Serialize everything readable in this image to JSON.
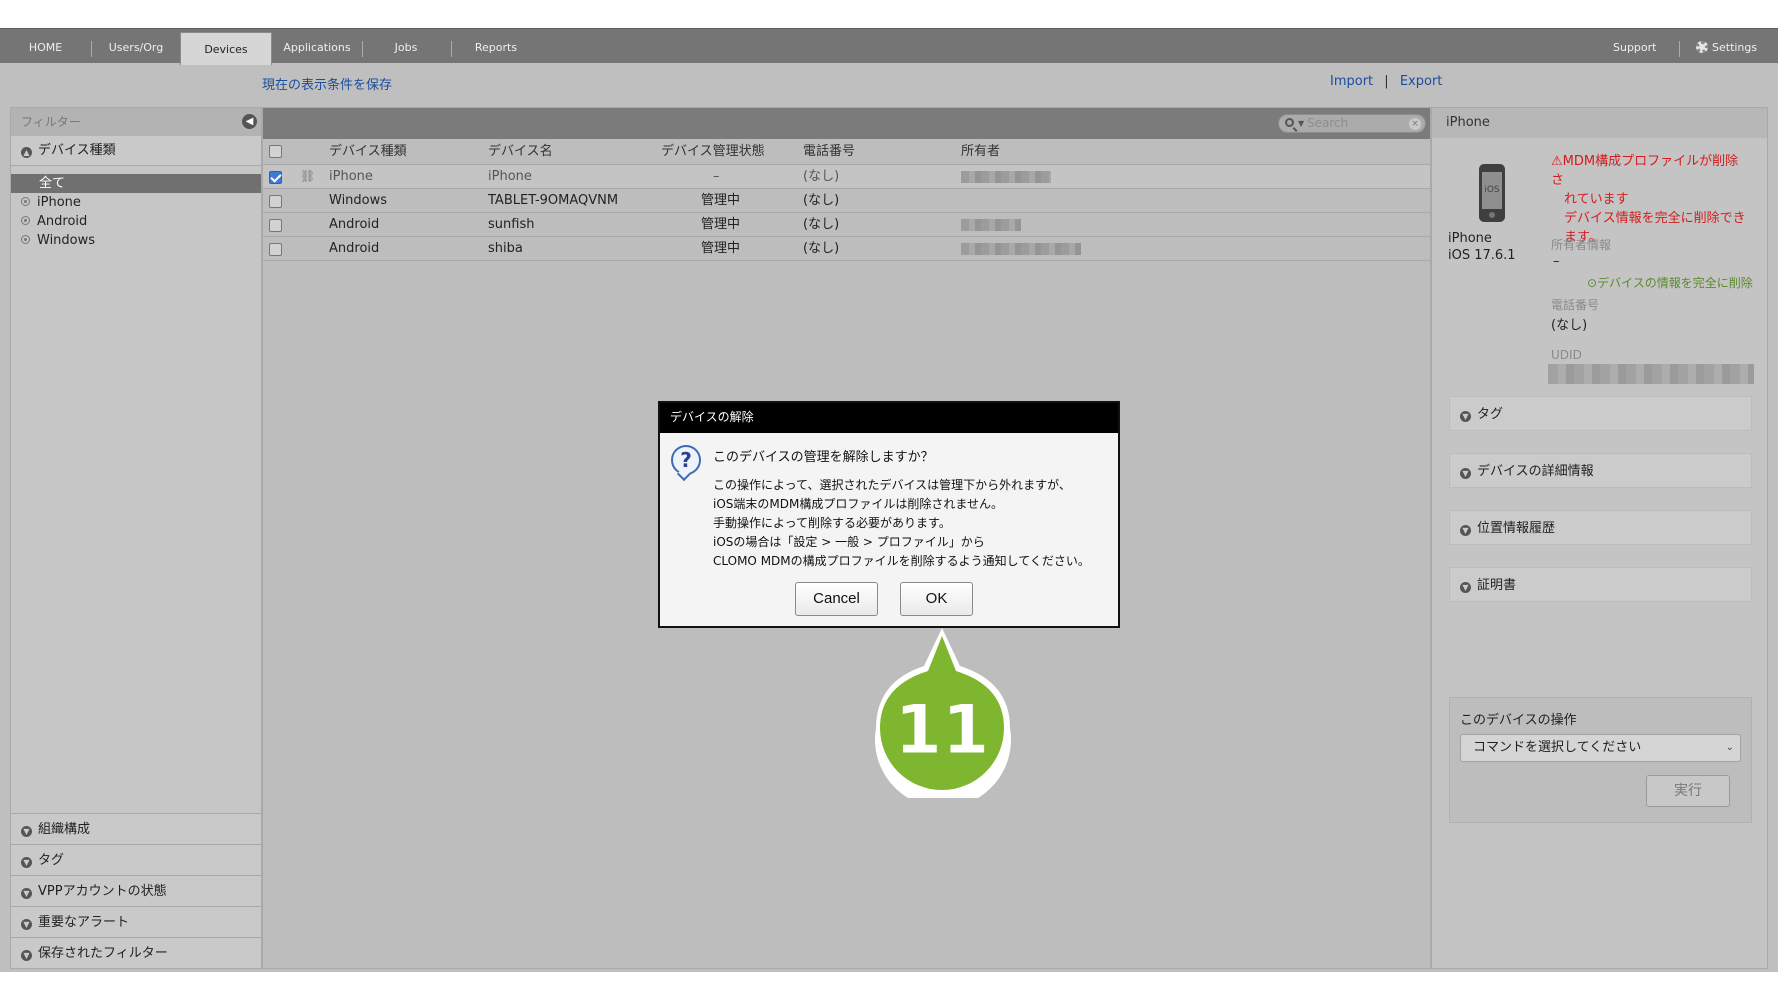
{
  "nav": {
    "tabs": [
      {
        "label": "HOME"
      },
      {
        "label": "Users/Org"
      },
      {
        "label": "Devices"
      },
      {
        "label": "Applications"
      },
      {
        "label": "Jobs"
      },
      {
        "label": "Reports"
      }
    ],
    "active_tab": "Devices",
    "support": "Support",
    "settings": "Settings"
  },
  "subbar": {
    "save_view": "現在の表示条件を保存",
    "import": "Import",
    "separator": "|",
    "export": "Export"
  },
  "sidebar": {
    "title": "フィルター",
    "device_type_header": "デバイス種類",
    "items": [
      {
        "label": "全て",
        "selected": true
      },
      {
        "label": "iPhone",
        "selected": false
      },
      {
        "label": "Android",
        "selected": false
      },
      {
        "label": "Windows",
        "selected": false
      }
    ],
    "bottom_sections": [
      {
        "label": "組織構成"
      },
      {
        "label": "タグ"
      },
      {
        "label": "VPPアカウントの状態"
      },
      {
        "label": "重要なアラート"
      },
      {
        "label": "保存されたフィルター"
      }
    ]
  },
  "search": {
    "placeholder": "Search"
  },
  "table": {
    "columns": [
      "デバイス種類",
      "デバイス名",
      "デバイス管理状態",
      "電話番号",
      "所有者"
    ],
    "rows": [
      {
        "type": "iPhone",
        "name": "iPhone",
        "status": "–",
        "phone": "(なし)",
        "checked": true,
        "unlinked": true
      },
      {
        "type": "Windows",
        "name": "TABLET-9OMAQVNM",
        "status": "管理中",
        "phone": "(なし)",
        "checked": false,
        "unlinked": false
      },
      {
        "type": "Android",
        "name": "sunfish",
        "status": "管理中",
        "phone": "(なし)",
        "checked": false,
        "unlinked": false
      },
      {
        "type": "Android",
        "name": "shiba",
        "status": "管理中",
        "phone": "(なし)",
        "checked": false,
        "unlinked": false
      }
    ]
  },
  "details": {
    "header": "iPhone",
    "device_model": "iPhone",
    "os_version": "iOS 17.6.1",
    "phone_screen_label": "iOS",
    "alert_lines": [
      "MDM構成プロファイルが削除さ",
      "れています",
      "デバイス情報を完全に削除でき",
      "ます。"
    ],
    "owner_label": "所有者情報",
    "owner_value": "–",
    "wipe_link": "デバイスの情報を完全に削除",
    "phone_label": "電話番号",
    "phone_value": "(なし)",
    "udid_label": "UDID",
    "sections": [
      {
        "label": "タグ"
      },
      {
        "label": "デバイスの詳細情報"
      },
      {
        "label": "位置情報履歴"
      },
      {
        "label": "証明書"
      }
    ],
    "operations": {
      "title": "このデバイスの操作",
      "select_placeholder": "コマンドを選択してください",
      "run": "実行"
    }
  },
  "dialog": {
    "title": "デバイスの解除",
    "question": "このデバイスの管理を解除しますか？",
    "body_lines": [
      "この操作によって、選択されたデバイスは管理下から外れますが、",
      "iOS端末のMDM構成プロファイルは削除されません。",
      "手動操作によって削除する必要があります。",
      "iOSの場合は「設定 > 一般 > プロファイル」から",
      "CLOMO MDMの構成プロファイルを削除するよう通知してください。"
    ],
    "cancel": "Cancel",
    "ok": "OK"
  },
  "callout": {
    "step": "11"
  },
  "colors": {
    "callout_green": "#7fb630",
    "alert_red": "#d41c1c",
    "link_blue": "#1a4d9e",
    "wipe_green": "#5b8a2b"
  }
}
